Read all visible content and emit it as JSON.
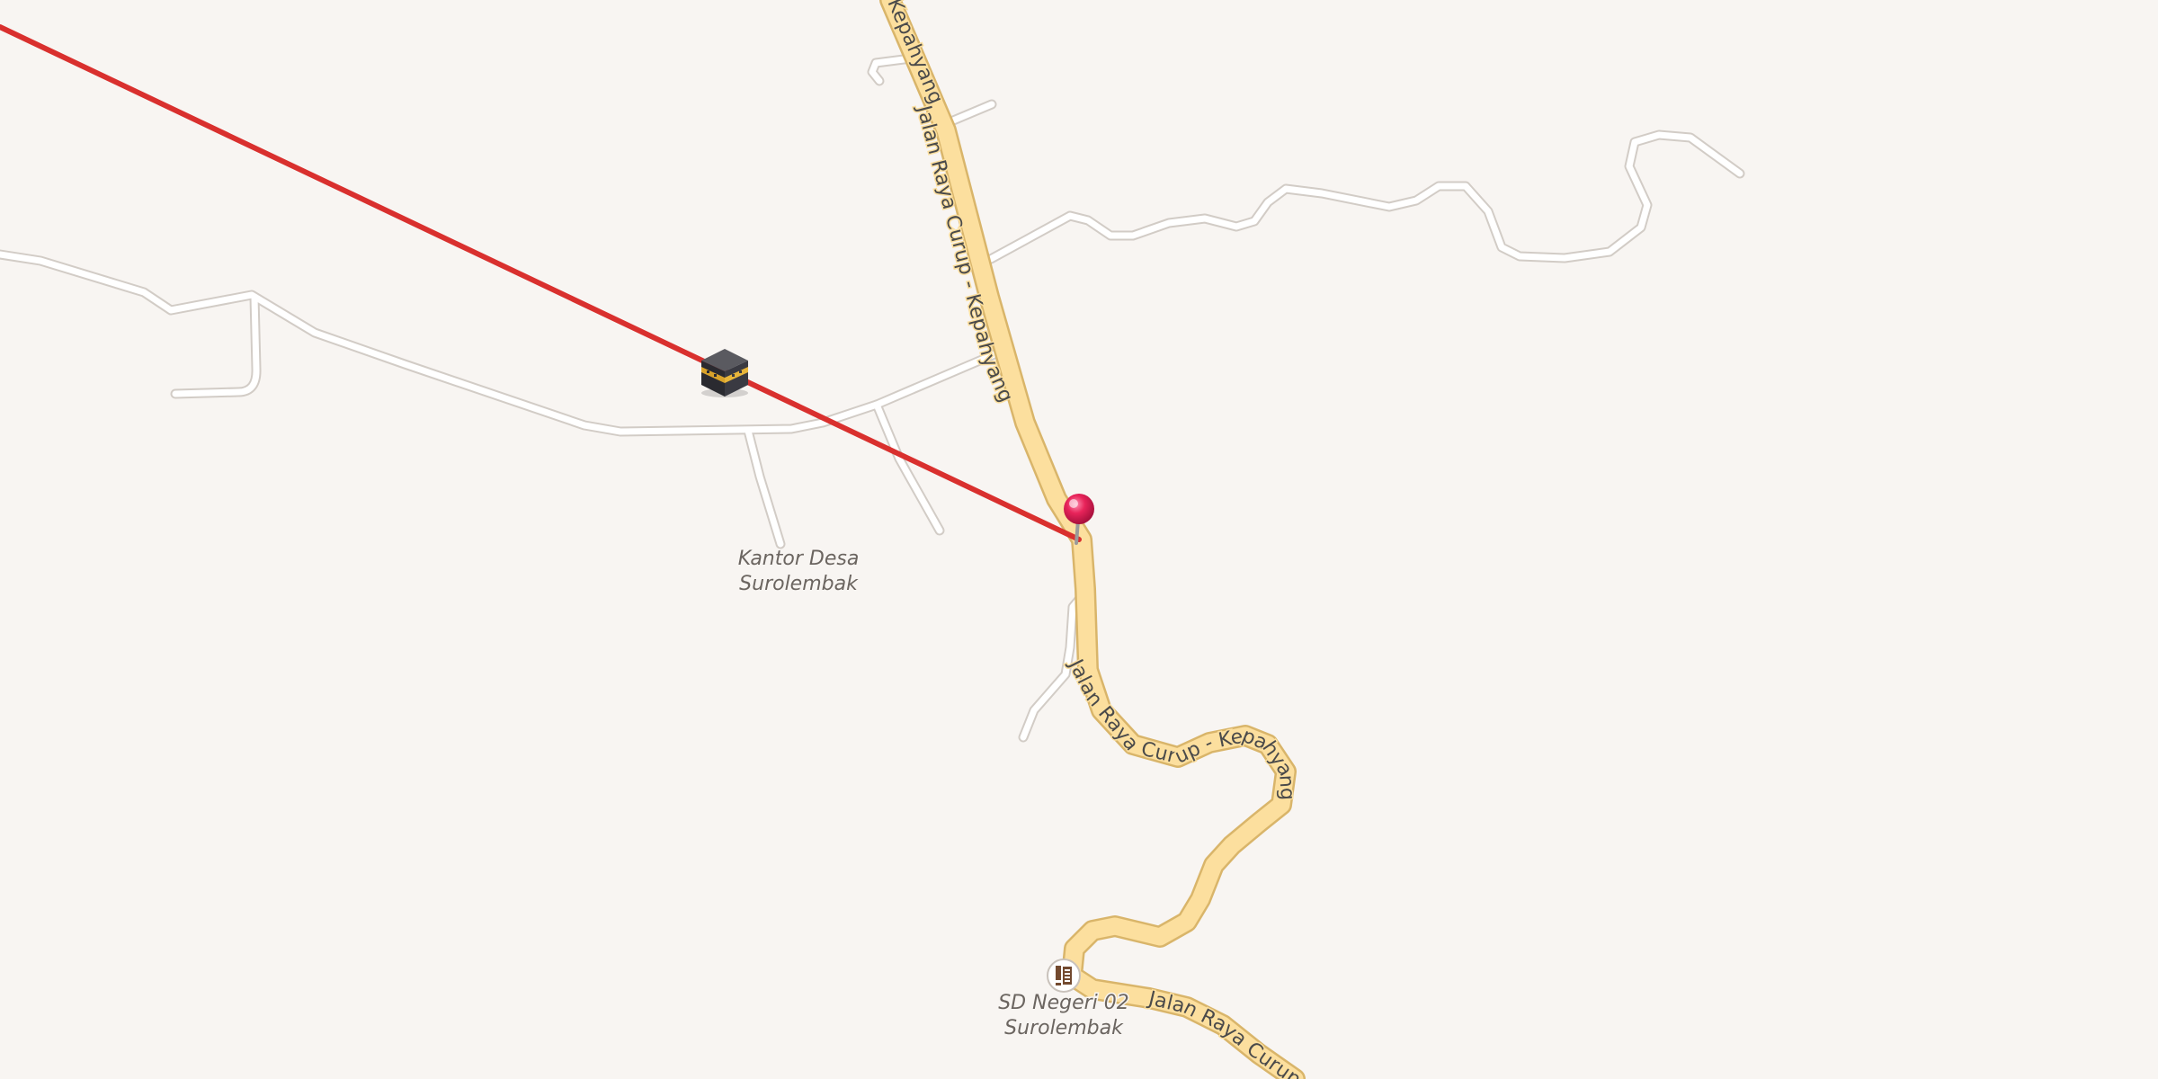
{
  "map": {
    "road_labels": {
      "top_fragment": "Kepahyang",
      "north_segment": "Jalan Raya Curup - Kepahyang",
      "middle_segment": "Jalan Raya Curup - Kepahyang",
      "bottom_segment": "Jalan Raya Curup"
    },
    "pois": {
      "village_office": {
        "line1": "Kantor Desa",
        "line2": "Surolembak"
      },
      "school": {
        "line1": "SD Negeri 02",
        "line2": "Surolembak",
        "icon": "school-icon"
      }
    },
    "markers": {
      "qibla_icon": "kaaba-icon",
      "location_pin": "location-pin-icon",
      "pin_color": "#e8245a"
    },
    "qibla_line_color": "#d9302e",
    "primary_road_color": "#fcdf9e",
    "minor_road_color": "#ffffff",
    "background_color": "#f8f5f2"
  }
}
